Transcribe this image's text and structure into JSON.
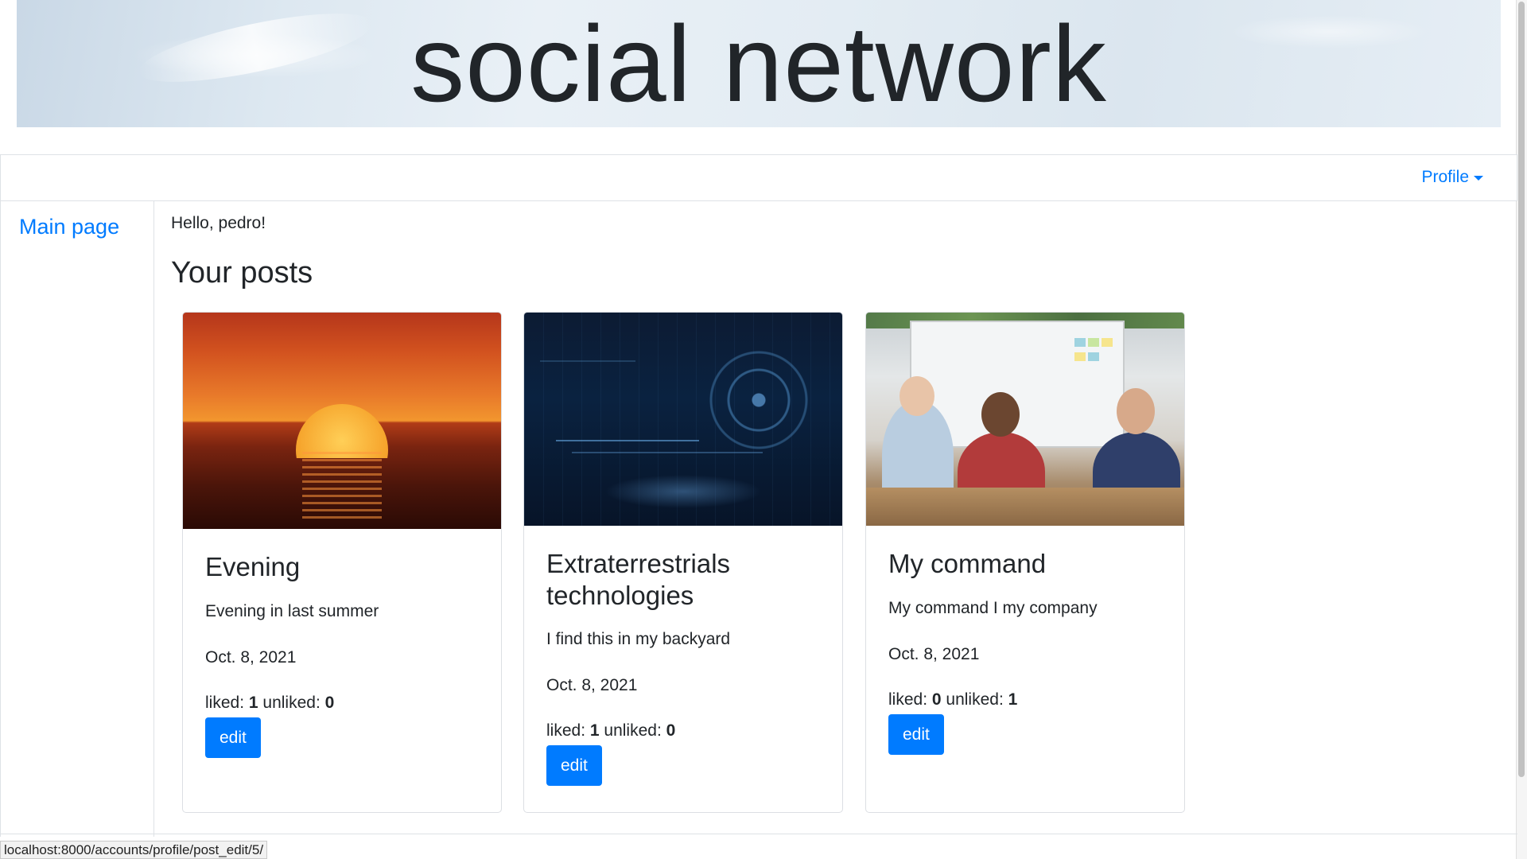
{
  "banner": {
    "title": "social network"
  },
  "navbar": {
    "profile_label": "Profile"
  },
  "sidebar": {
    "items": [
      {
        "label": "Main page"
      }
    ]
  },
  "main": {
    "greeting": "Hello, pedro!",
    "section_title": "Your posts",
    "posts": [
      {
        "title": "Evening",
        "text": "Evening in last summer",
        "date": "Oct. 8, 2021",
        "liked_label": "liked:",
        "liked": "1",
        "unliked_label": "unliked:",
        "unliked": "0",
        "edit_label": "edit",
        "image": "sunset-over-sea"
      },
      {
        "title": "Extraterrestrials technologies",
        "text": "I find this in my backyard",
        "date": "Oct. 8, 2021",
        "liked_label": "liked:",
        "liked": "1",
        "unliked_label": "unliked:",
        "unliked": "0",
        "edit_label": "edit",
        "image": "blue-tech-interface"
      },
      {
        "title": "My command",
        "text": "My command I my company",
        "date": "Oct. 8, 2021",
        "liked_label": "liked:",
        "liked": "0",
        "unliked_label": "unliked:",
        "unliked": "1",
        "edit_label": "edit",
        "image": "team-meeting-office"
      }
    ]
  },
  "status_bar": {
    "url": "localhost:8000/accounts/profile/post_edit/5/"
  },
  "colors": {
    "link": "#007bff",
    "button": "#007bff",
    "text": "#212529",
    "border": "#dee2e6"
  }
}
